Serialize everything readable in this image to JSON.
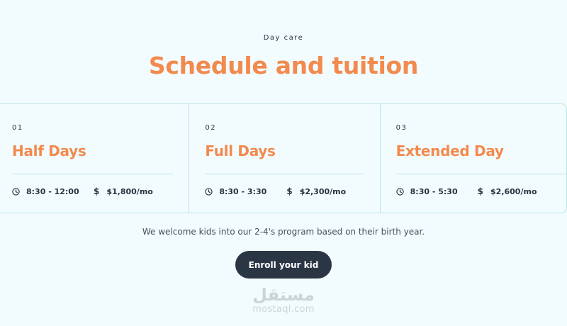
{
  "section": {
    "eyebrow": "Day care",
    "title": "Schedule and tuition"
  },
  "plans": [
    {
      "number": "01",
      "title": "Half Days",
      "time": "8:30 - 12:00",
      "price": "$1,800/mo"
    },
    {
      "number": "02",
      "title": "Full Days",
      "time": "8:30 - 3:30",
      "price": "$2,300/mo"
    },
    {
      "number": "03",
      "title": "Extended Day",
      "time": "8:30 - 5:30",
      "price": "$2,600/mo"
    }
  ],
  "icons": {
    "time": "clock-icon",
    "price": "dollar-icon",
    "price_glyph": "$"
  },
  "note": "We welcome kids into our 2-4's program based on their birth year.",
  "cta": {
    "label": "Enroll your kid"
  },
  "watermark": {
    "mark": "مستقل",
    "text": "mostaql.com"
  },
  "colors": {
    "background": "#f2fbfd",
    "accent": "#f28a4e",
    "text": "#2a3440",
    "border": "#bfe3e6",
    "button": "#2b3645"
  }
}
